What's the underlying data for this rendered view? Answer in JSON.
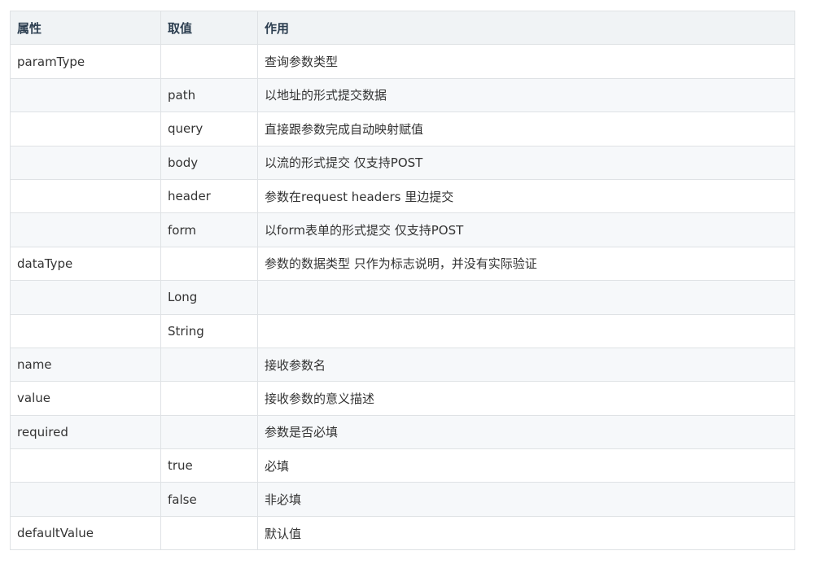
{
  "table": {
    "headers": [
      "属性",
      "取值",
      "作用"
    ],
    "rows": [
      [
        "paramType",
        "",
        "查询参数类型"
      ],
      [
        "",
        "path",
        "以地址的形式提交数据"
      ],
      [
        "",
        "query",
        "直接跟参数完成自动映射赋值"
      ],
      [
        "",
        "body",
        "以流的形式提交 仅支持POST"
      ],
      [
        "",
        "header",
        "参数在request headers 里边提交"
      ],
      [
        "",
        "form",
        "以form表单的形式提交 仅支持POST"
      ],
      [
        "dataType",
        "",
        "参数的数据类型 只作为标志说明，并没有实际验证"
      ],
      [
        "",
        "Long",
        ""
      ],
      [
        "",
        "String",
        ""
      ],
      [
        "name",
        "",
        "接收参数名"
      ],
      [
        "value",
        "",
        "接收参数的意义描述"
      ],
      [
        "required",
        "",
        "参数是否必填"
      ],
      [
        "",
        "true",
        "必填"
      ],
      [
        "",
        "false",
        "非必填"
      ],
      [
        "defaultValue",
        "",
        "默认值"
      ]
    ]
  }
}
